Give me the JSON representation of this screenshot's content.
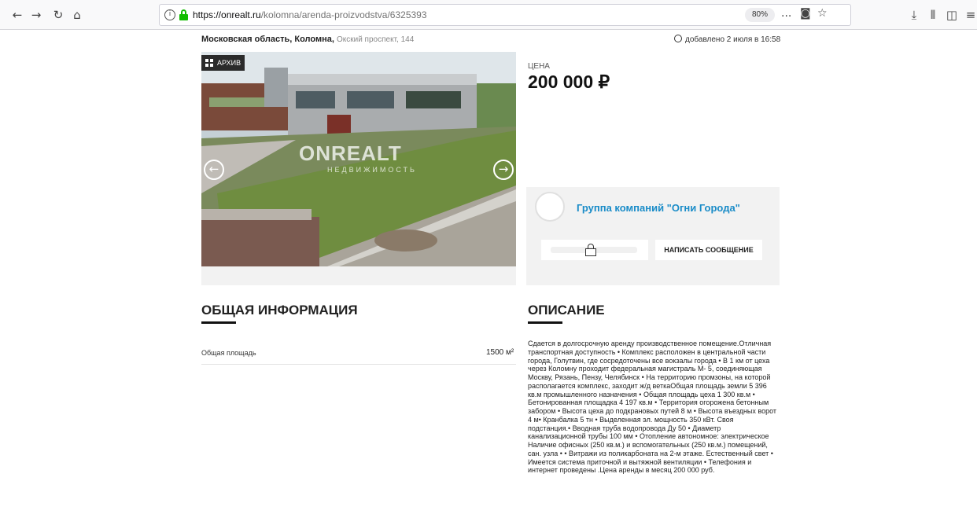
{
  "browser": {
    "url_host": "https://onrealt.ru",
    "url_path": "/kolomna/arenda-proizvodstva/6325393",
    "zoom": "80%",
    "more_icon": "...",
    "icons": [
      "back-icon",
      "forward-icon",
      "reload-icon",
      "home-icon",
      "info-icon",
      "lock-icon",
      "pocket-icon",
      "bookmark-star-icon",
      "download-icon",
      "library-icon",
      "sidebar-icon",
      "menu-icon"
    ]
  },
  "listing": {
    "region": "Московская область, Коломна,",
    "address": "Окский проспект, 144",
    "added": "добавлено 2 июля в 16:58",
    "archive_badge": "АРХИВ",
    "watermark": "ONREALT",
    "watermark_sub": "НЕДВИЖИМОСТЬ",
    "price_label": "ЦЕНА",
    "price": "200 000 ₽",
    "seller_name": "Группа компаний \"Огни Города\"",
    "write_message": "НАПИСАТЬ СООБЩЕНИЕ"
  },
  "general": {
    "heading": "ОБЩАЯ ИНФОРМАЦИЯ",
    "area_label": "Общая площадь",
    "area_value": "1500 м²"
  },
  "description": {
    "heading": "ОПИСАНИЕ",
    "text": "Сдается в долгосрочную аренду производственное помещение.Отличная транспортная доступность • Комплекс расположен в центральной части города, Голутвин, где сосредоточены все вокзалы города • В 1 км от цеха через Коломну проходит федеральная магистраль М- 5, соединяющая Москву, Рязань, Пензу, Челябинск • На территорию промзоны, на которой располагается комплекс, заходит ж/д веткаОбщая площадь земли 5 396 кв.м промышленного назначения • Общая площадь цеха 1 300 кв.м • Бетонированная площадка 4 197 кв.м • Территория огорожена бетонным забором • Высота цеха до подкрановых путей 8 м • Высота въездных ворот 4 м• Кранбалка 5 тн • Выделенная эл. мощность 350 кВт. Своя подстанция.• Вводная труба водопровода Ду 50 • Диаметр канализационной трубы 100 мм • Отопление автономное: электрическое Наличие офисных (250 кв.м.) и вспомогательных (250 кв.м.) помещений, сан. узла • • Витражи из поликарбоната на 2-м этаже. Естественный свет • Имеется система приточной и вытяжной вентиляции • Телефония и интернет проведены .Цена аренды в месяц 200 000 руб."
  }
}
